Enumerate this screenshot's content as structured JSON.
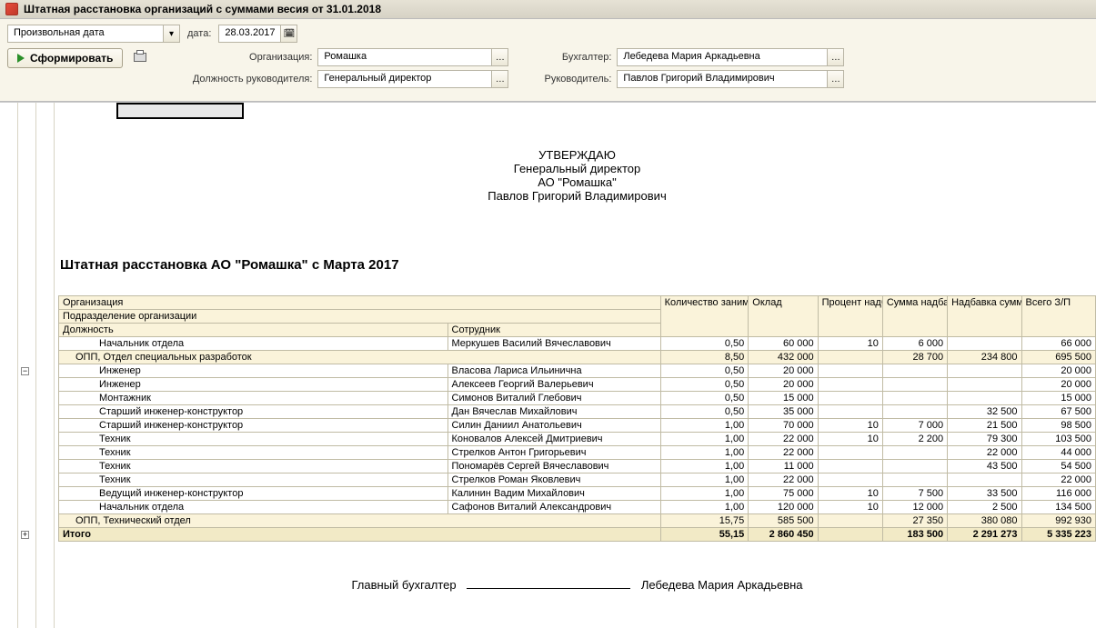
{
  "window": {
    "title": "Штатная расстановка организаций с суммами весия от 31.01.2018"
  },
  "toolbar": {
    "date_mode": "Произвольная дата",
    "date_label": "дата:",
    "date_value": "28.03.2017",
    "form_button": "Сформировать",
    "org_label": "Организация:",
    "org_value": "Ромашка",
    "accountant_label": "Бухгалтер:",
    "accountant_value": "Лебедева Мария Аркадьевна",
    "manager_title_label": "Должность руководителя:",
    "manager_title_value": "Генеральный директор",
    "manager_label": "Руководитель:",
    "manager_value": "Павлов Григорий Владимирович"
  },
  "approve": {
    "line1": "УТВЕРЖДАЮ",
    "line2": "Генеральный директор",
    "line3": "АО \"Ромашка\"",
    "line4": "Павлов Григорий Владимирович"
  },
  "doc_title": "Штатная расстановка АО \"Ромашка\" с Марта 2017",
  "table": {
    "headers": {
      "org": "Организация",
      "subdiv": "Подразделение организации",
      "position": "Должность",
      "employee": "Сотрудник",
      "count": "Количество занимаемых ставок",
      "salary": "Оклад",
      "bonus_pct": "Процент надбавки",
      "bonus_sum": "Сумма надбавки",
      "bonus_amt": "Надбавка суммой",
      "total": "Всего З/П",
      "grand_total": "Итого"
    },
    "rows": [
      {
        "lvl": 3,
        "pos": "Начальник отдела",
        "emp": "Меркушев Василий Вячеславович",
        "cnt": "0,50",
        "sal": "60 000",
        "pct": "10",
        "bsum": "6 000",
        "bamt": "",
        "tot": "66 000"
      },
      {
        "lvl": 2,
        "alt": true,
        "pos": "ОПП, Отдел специальных разработок",
        "emp": "",
        "cnt": "8,50",
        "sal": "432 000",
        "pct": "",
        "bsum": "28 700",
        "bamt": "234 800",
        "tot": "695 500"
      },
      {
        "lvl": 3,
        "pos": "Инженер",
        "emp": "Власова Лариса Ильинична",
        "cnt": "0,50",
        "sal": "20 000",
        "pct": "",
        "bsum": "",
        "bamt": "",
        "tot": "20 000"
      },
      {
        "lvl": 3,
        "pos": "Инженер",
        "emp": "Алексеев Георгий Валерьевич",
        "cnt": "0,50",
        "sal": "20 000",
        "pct": "",
        "bsum": "",
        "bamt": "",
        "tot": "20 000"
      },
      {
        "lvl": 3,
        "pos": "Монтажник",
        "emp": "Симонов Виталий Глебович",
        "cnt": "0,50",
        "sal": "15 000",
        "pct": "",
        "bsum": "",
        "bamt": "",
        "tot": "15 000"
      },
      {
        "lvl": 3,
        "pos": "Старший инженер-конструктор",
        "emp": "Дан Вячеслав Михайлович",
        "cnt": "0,50",
        "sal": "35 000",
        "pct": "",
        "bsum": "",
        "bamt": "32 500",
        "tot": "67 500"
      },
      {
        "lvl": 3,
        "pos": "Старший инженер-конструктор",
        "emp": "Силин Даниил Анатольевич",
        "cnt": "1,00",
        "sal": "70 000",
        "pct": "10",
        "bsum": "7 000",
        "bamt": "21 500",
        "tot": "98 500"
      },
      {
        "lvl": 3,
        "pos": "Техник",
        "emp": "Коновалов Алексей Дмитриевич",
        "cnt": "1,00",
        "sal": "22 000",
        "pct": "10",
        "bsum": "2 200",
        "bamt": "79 300",
        "tot": "103 500"
      },
      {
        "lvl": 3,
        "pos": "Техник",
        "emp": "Стрелков Антон Григорьевич",
        "cnt": "1,00",
        "sal": "22 000",
        "pct": "",
        "bsum": "",
        "bamt": "22 000",
        "tot": "44 000"
      },
      {
        "lvl": 3,
        "pos": "Техник",
        "emp": "Пономарёв Сергей Вячеславович",
        "cnt": "1,00",
        "sal": "11 000",
        "pct": "",
        "bsum": "",
        "bamt": "43 500",
        "tot": "54 500"
      },
      {
        "lvl": 3,
        "pos": "Техник",
        "emp": "Стрелков Роман Яковлевич",
        "cnt": "1,00",
        "sal": "22 000",
        "pct": "",
        "bsum": "",
        "bamt": "",
        "tot": "22 000"
      },
      {
        "lvl": 3,
        "pos": "Ведущий инженер-конструктор",
        "emp": "Калинин Вадим Михайлович",
        "cnt": "1,00",
        "sal": "75 000",
        "pct": "10",
        "bsum": "7 500",
        "bamt": "33 500",
        "tot": "116 000"
      },
      {
        "lvl": 3,
        "pos": "Начальник отдела",
        "emp": "Сафонов Виталий Александрович",
        "cnt": "1,00",
        "sal": "120 000",
        "pct": "10",
        "bsum": "12 000",
        "bamt": "2 500",
        "tot": "134 500"
      },
      {
        "lvl": 2,
        "alt": true,
        "pos": "ОПП, Технический отдел",
        "emp": "",
        "cnt": "15,75",
        "sal": "585 500",
        "pct": "",
        "bsum": "27 350",
        "bamt": "380 080",
        "tot": "992 930"
      }
    ],
    "totals": {
      "cnt": "55,15",
      "sal": "2 860 450",
      "pct": "",
      "bsum": "183 500",
      "bamt": "2 291 273",
      "tot": "5 335 223"
    }
  },
  "signature": {
    "role": "Главный бухгалтер",
    "name": "Лебедева Мария Аркадьевна"
  }
}
